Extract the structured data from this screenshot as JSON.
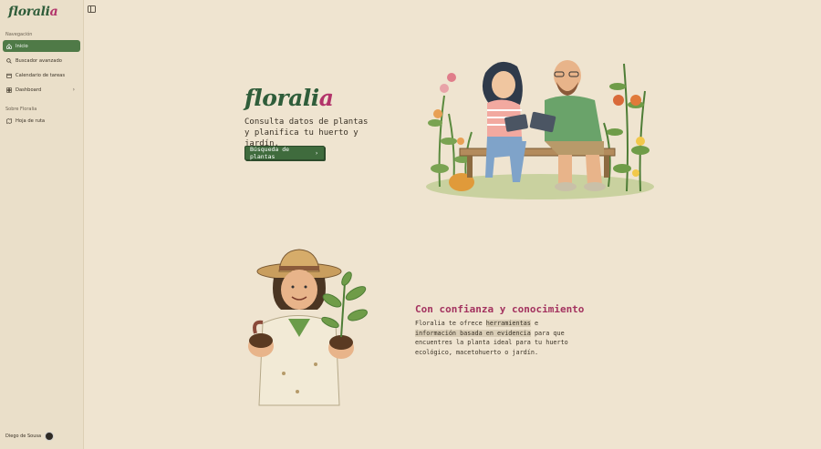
{
  "sidebar": {
    "logo_main": "florali",
    "logo_tail": "a",
    "nav_section": "Navegación",
    "items": [
      {
        "label": "Inicio",
        "icon": "home-icon",
        "active": true
      },
      {
        "label": "Buscador avanzado",
        "icon": "search-icon"
      },
      {
        "label": "Calendario de tareas",
        "icon": "calendar-icon"
      },
      {
        "label": "Dashboard",
        "icon": "dashboard-icon",
        "chevron": "›"
      }
    ],
    "about_section": "Sobre Floralia",
    "about_items": [
      {
        "label": "Hoja de ruta",
        "icon": "map-icon"
      }
    ],
    "user_name": "Diego de Sousa"
  },
  "hero": {
    "logo_main": "florali",
    "logo_tail": "a",
    "tagline": "Consulta datos de plantas y planifica tu huerto y jardín.",
    "cta_label": "Búsqueda de plantas",
    "cta_arrow": "›"
  },
  "feature": {
    "title": "Con confianza y conocimiento",
    "body_1": "Floralia te ofrece ",
    "hl_1": "herramientas",
    "body_2": " e ",
    "hl_2": "información basada en evidencia",
    "body_3": " para que encuentres la planta ideal para tu huerto ecológico, macetohuerto o jardín."
  },
  "colors": {
    "accent_green": "#3f6b3d",
    "accent_pink": "#a3325f",
    "background": "#efe4d0"
  }
}
